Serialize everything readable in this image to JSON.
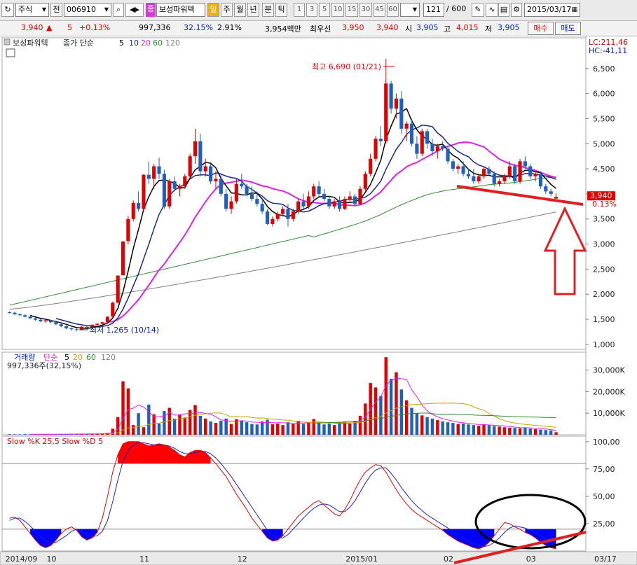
{
  "toolbar": {
    "market": "주식",
    "mode": "전",
    "code": "006910",
    "badge": "종",
    "name": "보성파워텍",
    "period_active": "일",
    "periods": [
      "주",
      "월",
      "년",
      "분",
      "틱"
    ],
    "minutes": [
      "1",
      "3",
      "5",
      "10",
      "15",
      "30",
      "45",
      "60"
    ],
    "count": "121",
    "count_total": "/ 600",
    "date": "2015/03/17"
  },
  "quote": {
    "price": "3,940",
    "arrow": "▲",
    "change": "5",
    "change_pct": "+0.13%",
    "volume": "997,336",
    "volume_ratio": "32.15%",
    "turnover": "2.91%",
    "amount": "3,954백만",
    "best_label": "최우선",
    "best_ask": "3,950",
    "best_bid": "3,940",
    "open_label": "시",
    "open": "3,905",
    "high_label": "고",
    "high": "4,015",
    "low_label": "저",
    "low": "3,905",
    "buy_button": "매수",
    "sell_button": "매도"
  },
  "colors": {
    "up": "#e00000",
    "down": "#1f5fbf",
    "ma5": "#000000",
    "ma10": "#1a2a8a",
    "ma20": "#e020e0",
    "ma60": "#2e8b2e",
    "ma120": "#808080",
    "annotation": "#e02020",
    "stoch_k": "#e00000",
    "stoch_d": "#2020c0"
  },
  "chart_data": [
    {
      "type": "candlestick",
      "name": "price",
      "legend": [
        "보성파워텍",
        "종가 단순",
        "5",
        "10",
        "20",
        "60",
        "120"
      ],
      "right_labels": {
        "lc": "LC:211,46",
        "hc": "HC:-41,11",
        "last_price": "3,940",
        "last_pct": "0.13%"
      },
      "ylim": [
        900,
        7000
      ],
      "y_ticks": [
        1000,
        1500,
        2000,
        2500,
        3000,
        3500,
        4000,
        4500,
        5000,
        5500,
        6000,
        6500
      ],
      "y_tick_labels": [
        "1,000",
        "1,500",
        "2,000",
        "2,500",
        "3,000",
        "3,500",
        "",
        "4,500",
        "5,000",
        "5,500",
        "6,000",
        "6,500"
      ],
      "annotations": {
        "max": "최고 6,690 (01/21)",
        "min": "최저 1,265 (10/14)"
      },
      "pad_right_bars": 5,
      "ma_tails": {
        "60": {
          "start": 1780,
          "end": 4320
        },
        "120": {
          "start": 1700,
          "end": 3640
        }
      },
      "candles": [
        [
          1640,
          1660,
          1610,
          1630
        ],
        [
          1630,
          1650,
          1590,
          1600
        ],
        [
          1600,
          1620,
          1560,
          1580
        ],
        [
          1580,
          1600,
          1540,
          1550
        ],
        [
          1550,
          1570,
          1500,
          1520
        ],
        [
          1520,
          1540,
          1470,
          1490
        ],
        [
          1490,
          1510,
          1440,
          1460
        ],
        [
          1460,
          1500,
          1430,
          1480
        ],
        [
          1480,
          1490,
          1420,
          1440
        ],
        [
          1440,
          1460,
          1380,
          1400
        ],
        [
          1400,
          1420,
          1340,
          1360
        ],
        [
          1360,
          1380,
          1300,
          1320
        ],
        [
          1320,
          1340,
          1270,
          1300
        ],
        [
          1300,
          1320,
          1265,
          1290
        ],
        [
          1290,
          1360,
          1280,
          1350
        ],
        [
          1350,
          1380,
          1320,
          1330
        ],
        [
          1330,
          1400,
          1310,
          1390
        ],
        [
          1390,
          1420,
          1370,
          1410
        ],
        [
          1410,
          1450,
          1400,
          1440
        ],
        [
          1440,
          1560,
          1430,
          1550
        ],
        [
          1550,
          1850,
          1540,
          1830
        ],
        [
          1830,
          2380,
          1820,
          2370
        ],
        [
          2380,
          3060,
          2370,
          3050
        ],
        [
          3060,
          3560,
          2990,
          3500
        ],
        [
          3500,
          3870,
          3450,
          3820
        ],
        [
          3820,
          4050,
          3650,
          3700
        ],
        [
          3700,
          4400,
          3650,
          4380
        ],
        [
          4380,
          4650,
          4200,
          4300
        ],
        [
          4300,
          4600,
          4100,
          4550
        ],
        [
          4550,
          4720,
          4300,
          4400
        ],
        [
          4400,
          4480,
          3700,
          3750
        ],
        [
          3750,
          4300,
          3700,
          4250
        ],
        [
          4250,
          4350,
          4050,
          4100
        ],
        [
          4100,
          4200,
          3950,
          4150
        ],
        [
          4150,
          4400,
          4100,
          4350
        ],
        [
          4350,
          4800,
          4300,
          4750
        ],
        [
          4750,
          5300,
          4600,
          5050
        ],
        [
          5050,
          5200,
          4350,
          4450
        ],
        [
          4450,
          4700,
          4350,
          4550
        ],
        [
          4550,
          4600,
          4200,
          4250
        ],
        [
          4250,
          4450,
          4100,
          4300
        ],
        [
          4300,
          4400,
          3950,
          4000
        ],
        [
          4000,
          4100,
          3650,
          3700
        ],
        [
          3700,
          3950,
          3600,
          3850
        ],
        [
          3850,
          4300,
          3800,
          4200
        ],
        [
          4200,
          4400,
          4100,
          4150
        ],
        [
          4150,
          4200,
          3950,
          4000
        ],
        [
          4000,
          4150,
          3850,
          3900
        ],
        [
          3900,
          4050,
          3750,
          3800
        ],
        [
          3800,
          3900,
          3600,
          3650
        ],
        [
          3650,
          3700,
          3380,
          3400
        ],
        [
          3400,
          3550,
          3350,
          3500
        ],
        [
          3500,
          3650,
          3450,
          3600
        ],
        [
          3600,
          3750,
          3550,
          3700
        ],
        [
          3700,
          3800,
          3350,
          3500
        ],
        [
          3500,
          3700,
          3450,
          3650
        ],
        [
          3650,
          3900,
          3600,
          3850
        ],
        [
          3850,
          4000,
          3700,
          3750
        ],
        [
          3750,
          4050,
          3700,
          3950
        ],
        [
          3950,
          4200,
          3900,
          4150
        ],
        [
          4150,
          4250,
          3950,
          4000
        ],
        [
          4000,
          4100,
          3850,
          3900
        ],
        [
          3900,
          3950,
          3700,
          3750
        ],
        [
          3750,
          3900,
          3700,
          3850
        ],
        [
          3850,
          3950,
          3650,
          3700
        ],
        [
          3700,
          3950,
          3680,
          3900
        ],
        [
          3900,
          4050,
          3850,
          3950
        ],
        [
          3950,
          4000,
          3750,
          3800
        ],
        [
          3800,
          4150,
          3780,
          4100
        ],
        [
          4100,
          4450,
          4050,
          4400
        ],
        [
          4400,
          4800,
          4350,
          4700
        ],
        [
          4700,
          5150,
          4650,
          5100
        ],
        [
          5100,
          5350,
          4950,
          5050
        ],
        [
          5050,
          6690,
          5000,
          6200
        ],
        [
          6200,
          6250,
          5600,
          5700
        ],
        [
          5700,
          6000,
          5500,
          5900
        ],
        [
          5900,
          6050,
          5200,
          5300
        ],
        [
          5300,
          5450,
          5050,
          5400
        ],
        [
          5400,
          5500,
          4950,
          5000
        ],
        [
          5000,
          5150,
          4700,
          4800
        ],
        [
          4800,
          5300,
          4750,
          5250
        ],
        [
          5250,
          5300,
          4900,
          5000
        ],
        [
          5000,
          5100,
          4750,
          4850
        ],
        [
          4850,
          5000,
          4700,
          4950
        ],
        [
          4950,
          5050,
          4850,
          4900
        ],
        [
          4900,
          4950,
          4600,
          4650
        ],
        [
          4650,
          4700,
          4450,
          4500
        ],
        [
          4500,
          4600,
          4400,
          4550
        ],
        [
          4550,
          4650,
          4350,
          4400
        ],
        [
          4400,
          4500,
          4300,
          4350
        ],
        [
          4350,
          4500,
          4200,
          4250
        ],
        [
          4250,
          4400,
          4200,
          4350
        ],
        [
          4350,
          4550,
          4300,
          4500
        ],
        [
          4500,
          4550,
          4350,
          4400
        ],
        [
          4400,
          4450,
          4150,
          4200
        ],
        [
          4200,
          4300,
          4150,
          4250
        ],
        [
          4250,
          4400,
          4200,
          4350
        ],
        [
          4350,
          4650,
          4300,
          4550
        ],
        [
          4550,
          4600,
          4200,
          4250
        ],
        [
          4250,
          4700,
          4200,
          4650
        ],
        [
          4650,
          4750,
          4500,
          4550
        ],
        [
          4550,
          4600,
          4300,
          4350
        ],
        [
          4350,
          4450,
          4250,
          4400
        ],
        [
          4400,
          4450,
          4100,
          4150
        ],
        [
          4150,
          4200,
          4000,
          4050
        ],
        [
          4050,
          4100,
          3950,
          4000
        ],
        [
          3905,
          4015,
          3905,
          3940
        ]
      ]
    },
    {
      "type": "bar",
      "name": "volume",
      "legend": [
        "거래량",
        "단순",
        "5",
        "20",
        "60",
        "120"
      ],
      "sub_label": "997,336주(32,15%)",
      "ylim": [
        0,
        38000
      ],
      "y_ticks": [
        10000,
        20000,
        30000
      ],
      "y_tick_labels": [
        "10,000K",
        "20,000K",
        "30,000K"
      ],
      "values": [
        250,
        220,
        200,
        260,
        230,
        280,
        300,
        260,
        240,
        300,
        320,
        350,
        380,
        300,
        420,
        380,
        460,
        520,
        600,
        900,
        2800,
        8200,
        24800,
        21500,
        4500,
        10000,
        3500,
        14000,
        9500,
        5200,
        11000,
        12500,
        7500,
        9500,
        8000,
        11500,
        13800,
        8800,
        7500,
        6200,
        5500,
        6500,
        7500,
        5000,
        7200,
        6400,
        5800,
        5000,
        4800,
        6200,
        7000,
        4900,
        5200,
        4500,
        5800,
        5200,
        6500,
        5000,
        5500,
        7300,
        5500,
        4800,
        5200,
        4500,
        6000,
        6200,
        5200,
        6500,
        8800,
        14500,
        24000,
        22000,
        18000,
        36000,
        26000,
        29000,
        21000,
        16000,
        12500,
        10000,
        9000,
        8200,
        7500,
        6800,
        6200,
        5800,
        5500,
        5000,
        5200,
        4800,
        4500,
        4200,
        4800,
        4400,
        4000,
        3800,
        3500,
        3300,
        3200,
        3000,
        3400,
        2800,
        2600,
        2400,
        2200,
        2000,
        1200
      ]
    },
    {
      "type": "line",
      "name": "stochastic",
      "title": "Slow %K 25,5  Slow %D 5",
      "ylim": [
        0,
        105
      ],
      "y_ticks": [
        25,
        50,
        75,
        100
      ],
      "y_tick_labels": [
        "25,00",
        "50,00",
        "75,00",
        "100,00"
      ],
      "bands": [
        20,
        80
      ],
      "x_labels": [
        {
          "text": "2014/09",
          "at": 0
        },
        {
          "text": "10",
          "at": 8
        },
        {
          "text": "11",
          "at": 26
        },
        {
          "text": "12",
          "at": 45
        },
        {
          "text": "2015/01",
          "at": 66
        },
        {
          "text": "02",
          "at": 85
        },
        {
          "text": "03",
          "at": 101
        },
        {
          "text": "03/17",
          "at": 115
        }
      ],
      "k": [
        30,
        31,
        28,
        22,
        16,
        10,
        5,
        3,
        5,
        10,
        16,
        20,
        22,
        19,
        13,
        10,
        12,
        17,
        30,
        50,
        72,
        88,
        98,
        100,
        100,
        100,
        98,
        96,
        97,
        98,
        97,
        95,
        92,
        88,
        86,
        90,
        92,
        92,
        90,
        85,
        80,
        74,
        68,
        60,
        52,
        45,
        38,
        30,
        24,
        18,
        12,
        9,
        10,
        14,
        20,
        26,
        32,
        36,
        40,
        44,
        46,
        42,
        38,
        34,
        32,
        38,
        46,
        56,
        65,
        72,
        76,
        79,
        78,
        72,
        64,
        56,
        49,
        43,
        38,
        34,
        31,
        28,
        25,
        22,
        19,
        15,
        12,
        9,
        7,
        5,
        3,
        2,
        4,
        8,
        14,
        20,
        26,
        25,
        22,
        20,
        17,
        15,
        12,
        8,
        5,
        3,
        2
      ],
      "d": [
        28,
        30,
        30,
        27,
        23,
        18,
        13,
        9,
        7,
        8,
        11,
        14,
        18,
        20,
        18,
        15,
        13,
        14,
        18,
        28,
        45,
        65,
        82,
        92,
        97,
        99,
        99,
        98,
        97,
        97,
        97,
        96,
        94,
        91,
        89,
        89,
        90,
        91,
        91,
        89,
        85,
        80,
        74,
        68,
        61,
        54,
        47,
        40,
        33,
        26,
        19,
        14,
        12,
        12,
        15,
        20,
        25,
        30,
        35,
        39,
        42,
        43,
        42,
        39,
        36,
        36,
        40,
        46,
        54,
        62,
        69,
        74,
        76,
        76,
        71,
        65,
        58,
        52,
        46,
        41,
        37,
        33,
        30,
        27,
        24,
        21,
        18,
        15,
        12,
        9,
        7,
        5,
        4,
        5,
        8,
        12,
        17,
        21,
        23,
        22,
        21,
        19,
        17,
        14,
        11,
        8,
        6
      ]
    }
  ]
}
